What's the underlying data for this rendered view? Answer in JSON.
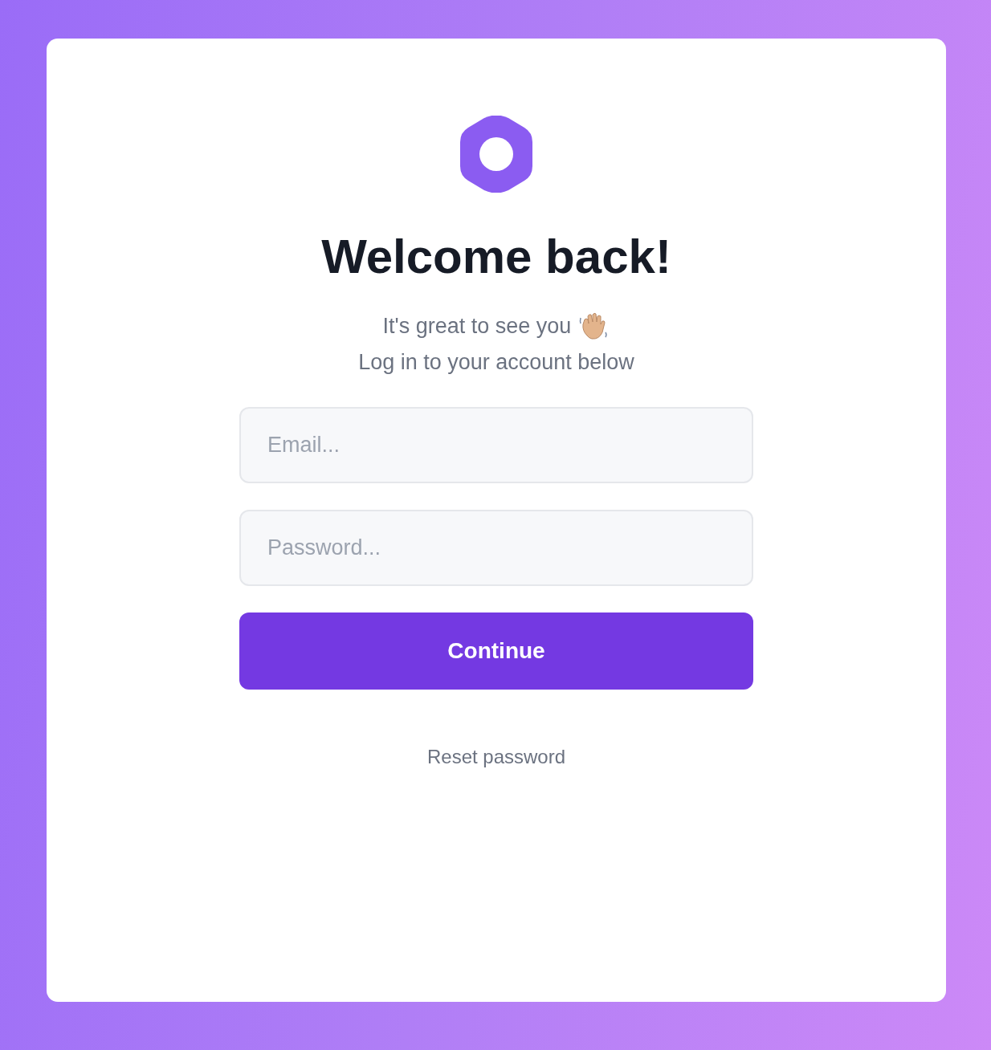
{
  "title": "Welcome back!",
  "subtitle_lines": [
    "It's great to see you",
    "Log in to your account below"
  ],
  "email_field": {
    "placeholder": "Email..."
  },
  "password_field": {
    "placeholder": "Password..."
  },
  "submit_button": "Continue",
  "reset_link": "Reset password"
}
